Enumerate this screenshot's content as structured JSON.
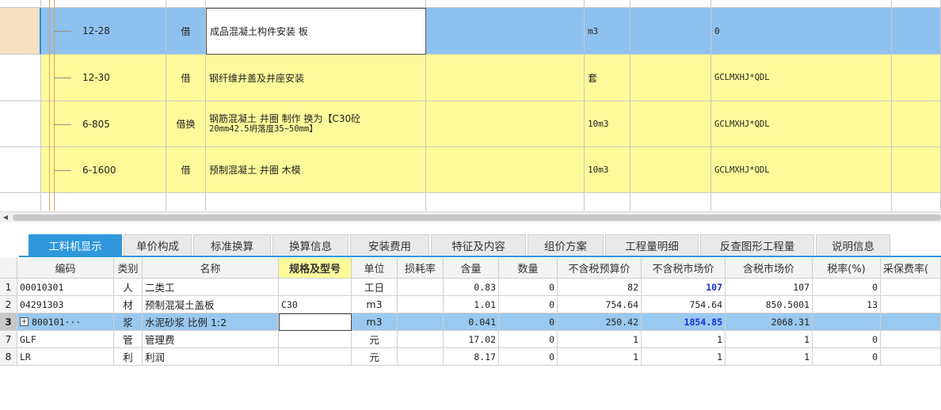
{
  "colors": {
    "upper_selected_row": "#8ec1ef",
    "upper_row": "#fefa9a",
    "tab_active": "#2f97dc",
    "lower_selected_row": "#99c9f0",
    "highlight_value": "#1a2fd6"
  },
  "upper_rows": [
    {
      "code": "12-28",
      "type": "借",
      "name": "成品混凝土构件安装 板",
      "unit": "m3",
      "expr": "0",
      "selected": true
    },
    {
      "code": "12-30",
      "type": "借",
      "name": "钢纤维井盖及井座安装",
      "unit": "套",
      "expr": "GCLMXHJ*QDL",
      "selected": false
    },
    {
      "code": "6-805",
      "type": "借换",
      "name_line1": "钢筋混凝土 井圈 制作  换为【C30砼",
      "name_line2": "20mm42.5坍落度35~50mm】",
      "unit": "10m3",
      "expr": "GCLMXHJ*QDL",
      "selected": false
    },
    {
      "code": "6-1600",
      "type": "借",
      "name": "预制混凝土 井圈 木模",
      "unit": "10m3",
      "expr": "GCLMXHJ*QDL",
      "selected": false
    }
  ],
  "tabs": [
    "工料机显示",
    "单价构成",
    "标准换算",
    "换算信息",
    "安装费用",
    "特征及内容",
    "组价方案",
    "工程量明细",
    "反查图形工程量",
    "说明信息"
  ],
  "lower_headers": [
    "编码",
    "类别",
    "名称",
    "规格及型号",
    "单位",
    "损耗率",
    "含量",
    "数量",
    "不含税预算价",
    "不含税市场价",
    "含税市场价",
    "税率(%)",
    "采保费率("
  ],
  "lower_rows": [
    {
      "n": "1",
      "code": "00010301",
      "cat": "人",
      "name": "二类工",
      "spec": "",
      "unit": "工日",
      "loss": "",
      "qty": "0.83",
      "amount": "0",
      "budget": "82",
      "market": "107",
      "market_tax": "107",
      "tax": "0"
    },
    {
      "n": "2",
      "code": "04291303",
      "cat": "材",
      "name": "预制混凝土盖板",
      "spec": "C30",
      "unit": "m3",
      "loss": "",
      "qty": "1.01",
      "amount": "0",
      "budget": "754.64",
      "market": "754.64",
      "market_tax": "850.5001",
      "tax": "13"
    },
    {
      "n": "3",
      "code": "800101···",
      "cat": "浆",
      "name": "水泥砂浆 比例 1:2",
      "spec": "",
      "unit": "m3",
      "loss": "",
      "qty": "0.041",
      "amount": "0",
      "budget": "250.42",
      "market": "1854.85",
      "market_tax": "2068.31",
      "tax": ""
    },
    {
      "n": "7",
      "code": "GLF",
      "cat": "管",
      "name": "管理费",
      "spec": "",
      "unit": "元",
      "loss": "",
      "qty": "17.02",
      "amount": "0",
      "budget": "1",
      "market": "1",
      "market_tax": "1",
      "tax": "0"
    },
    {
      "n": "8",
      "code": "LR",
      "cat": "利",
      "name": "利润",
      "spec": "",
      "unit": "元",
      "loss": "",
      "qty": "8.17",
      "amount": "0",
      "budget": "1",
      "market": "1",
      "market_tax": "1",
      "tax": "0"
    }
  ]
}
